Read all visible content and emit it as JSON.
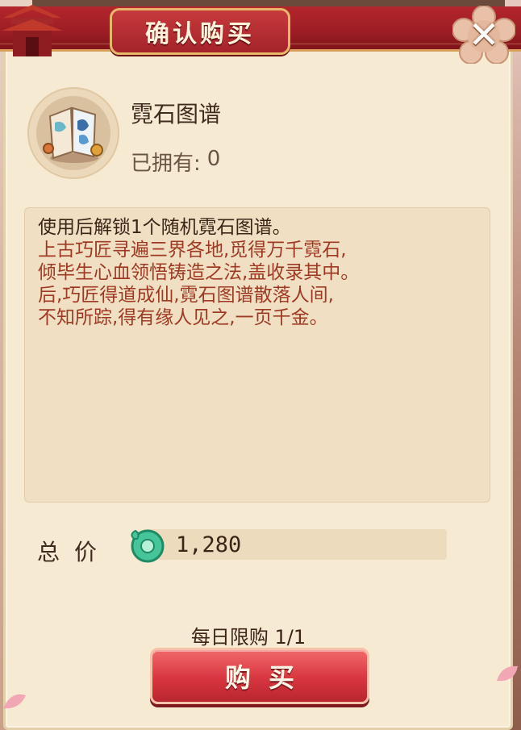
{
  "dialog": {
    "title": "确认购买",
    "close_label": "✕"
  },
  "item": {
    "name": "霓石图谱",
    "owned_label": "已拥有:",
    "owned_count": "0"
  },
  "description": {
    "effect": "使用后解锁1个随机霓石图谱。",
    "lore_lines": [
      "上古巧匠寻遍三界各地,觅得万千霓石,",
      "倾毕生心血领悟铸造之法,盖收录其中。",
      "后,巧匠得道成仙,霓石图谱散落人间,",
      "不知所踪,得有缘人见之,一页千金。"
    ]
  },
  "price": {
    "label": "总价",
    "currency_icon": "jade-coin-icon",
    "value": "1,280"
  },
  "purchase": {
    "daily_limit": "每日限购 1/1",
    "buy_label": "购买"
  },
  "colors": {
    "header_red": "#a4232a",
    "panel_bg": "#f7ead2",
    "button_red": "#d8363f",
    "lore_text": "#9e3a24"
  }
}
